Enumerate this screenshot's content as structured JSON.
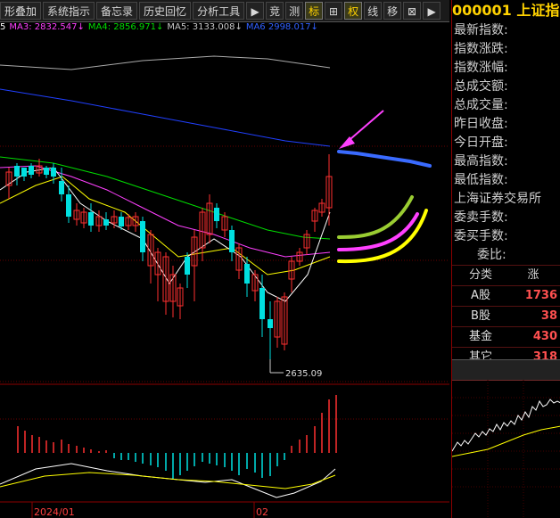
{
  "toolbar": {
    "items": [
      {
        "label": "形叠加"
      },
      {
        "label": "系统指示"
      },
      {
        "label": "备忘录"
      },
      {
        "label": "历史回忆"
      },
      {
        "label": "分析工具"
      },
      {
        "label": "▶"
      },
      {
        "label": "竞"
      },
      {
        "label": "测"
      },
      {
        "label": "标"
      },
      {
        "label": "⊞"
      },
      {
        "label": "权"
      },
      {
        "label": "线"
      },
      {
        "label": "移"
      },
      {
        "label": "⊠"
      },
      {
        "label": "▶"
      }
    ]
  },
  "ma_legend": [
    {
      "text": "5",
      "color": "#ffffff"
    },
    {
      "text": "MA3: 2832.547↓",
      "color": "#ff40ff"
    },
    {
      "text": "MA4: 2856.971↓",
      "color": "#00dd00"
    },
    {
      "text": "MA5: 3133.008↓",
      "color": "#c8c8c8"
    },
    {
      "text": "MA6  2998.017↓",
      "color": "#3060ff"
    }
  ],
  "chart": {
    "low_label": "2635.09",
    "axis_dates": [
      "2024/01",
      "02"
    ],
    "colors": {
      "up": "#ff3030",
      "down": "#00e0e0",
      "ma_white": "#ffffff",
      "ma_yellow": "#ffff00",
      "ma_magenta": "#ff40ff",
      "ma_green": "#00dd00",
      "ma_gray": "#aaaaaa",
      "ma_blue": "#2040ff",
      "annot_arrow": "#ff40ff"
    }
  },
  "right_panel": {
    "code": "000001",
    "name": "上证指",
    "info_labels": [
      "最新指数:",
      "指数涨跌:",
      "指数涨幅:",
      "总成交额:",
      "总成交量:",
      "昨日收盘:",
      "今日开盘:",
      "最高指数:",
      "最低指数:",
      "上海证券交易所",
      "委卖手数:",
      "委买手数:",
      "委比:"
    ],
    "categories": {
      "header": [
        "分类",
        "涨"
      ],
      "rows": [
        {
          "name": "A股",
          "value": "1736"
        },
        {
          "name": "B股",
          "value": "38"
        },
        {
          "name": "基金",
          "value": "430"
        },
        {
          "name": "其它",
          "value": "318"
        }
      ]
    }
  }
}
